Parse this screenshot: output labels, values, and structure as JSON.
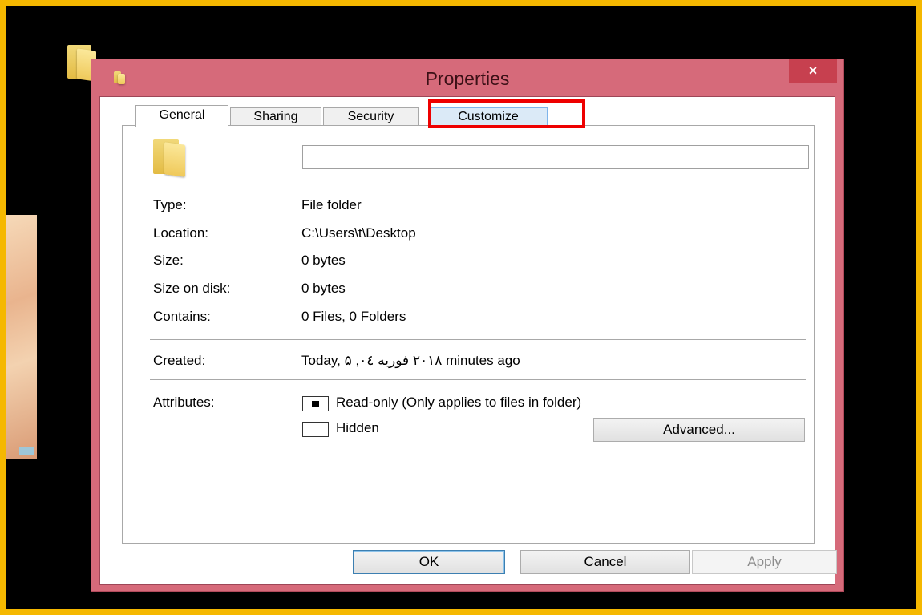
{
  "window": {
    "title": "Properties",
    "close_label": "×"
  },
  "tabs": [
    {
      "label": "General"
    },
    {
      "label": "Sharing"
    },
    {
      "label": "Security"
    },
    {
      "label": "Customize"
    }
  ],
  "name_field": {
    "value": ""
  },
  "details": {
    "type_label": "Type:",
    "type_value": "File folder",
    "location_label": "Location:",
    "location_value": "C:\\Users\\t\\Desktop",
    "size_label": "Size:",
    "size_value": "0 bytes",
    "size_on_disk_label": "Size on disk:",
    "size_on_disk_value": "0 bytes",
    "contains_label": "Contains:",
    "contains_value": "0 Files, 0 Folders",
    "created_label": "Created:",
    "created_value": "Today, ٢٠١٨ فوريه ٠٤, ۵ minutes ago"
  },
  "attributes": {
    "label": "Attributes:",
    "readonly_label": "Read-only (Only applies to files in folder)",
    "readonly_state": "indeterminate",
    "hidden_label": "Hidden",
    "hidden_state": "unchecked",
    "advanced_label": "Advanced..."
  },
  "buttons": {
    "ok": "OK",
    "cancel": "Cancel",
    "apply": "Apply"
  },
  "colors": {
    "window_frame": "#d66a7a",
    "screen_border": "#f5b800",
    "highlight": "#ee0000"
  }
}
